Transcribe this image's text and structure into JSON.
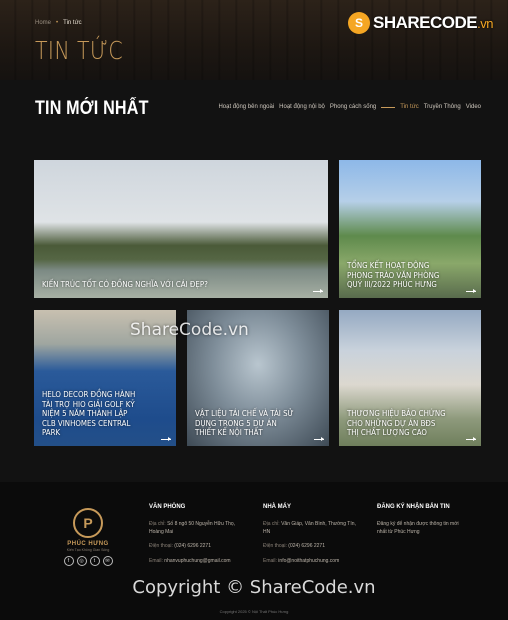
{
  "breadcrumb": {
    "home": "Home",
    "separator": "•",
    "current": "Tin tức"
  },
  "page_title": "TIN TỨC",
  "logo": {
    "mark": "S",
    "name": "SHARECODE",
    "suffix": ".vn"
  },
  "section_title": "TIN MỚI NHẤT",
  "tabs": [
    {
      "label": "Hoạt động bên ngoài"
    },
    {
      "label": "Hoạt động nội bộ"
    },
    {
      "label": "Phong cách sống"
    },
    {
      "label": "Tin tức"
    },
    {
      "label": "Truyền Thông"
    },
    {
      "label": "Video"
    }
  ],
  "articles": [
    {
      "title": "KIẾN TRÚC TỐT CÓ ĐỒNG NGHĨA VỚI CÁI ĐẸP?"
    },
    {
      "title": "TỔNG KẾT HOẠT ĐỘNG PHONG TRÀO VĂN PHÒNG QUÝ III/2022 PHÚC HƯNG"
    },
    {
      "title": "HELO DECOR ĐỒNG HÀNH TÀI TRỢ HIO GIẢI GOLF KỶ NIỆM 5 NĂM THÀNH LẬP CLB VINHOMES CENTRAL PARK"
    },
    {
      "title": "VẬT LIỆU TÁI CHẾ VÀ TÁI SỬ DỤNG TRONG 5 DỰ ÁN THIẾT KẾ NỘI THẤT"
    },
    {
      "title": "THƯƠNG HIỆU BẢO CHỨNG CHO NHỮNG DỰ ÁN BĐS THỊ CHẤT LƯỢNG CAO"
    }
  ],
  "watermark_center": "ShareCode.vn",
  "footer": {
    "brand": {
      "emblem": "P",
      "name": "PHÚC HƯNG",
      "tagline": "Kiến Tạo Không Gian Sống"
    },
    "socials": [
      "f",
      "◎",
      "t",
      "✉"
    ],
    "office": {
      "heading": "VĂN PHÒNG",
      "address_label": "Địa chỉ:",
      "address": "Số 8 ngõ 50 Nguyễn Hữu Thọ, Hoàng Mai",
      "phone_label": "Điện thoại:",
      "phone": "(024) 6296 2271",
      "email_label": "Email:",
      "email": "nhanvuphuchung@gmail.com"
    },
    "factory": {
      "heading": "NHÀ MÁY",
      "address_label": "Địa chỉ:",
      "address": "Văn Giáp, Văn Bình, Thường Tín, HN",
      "phone_label": "Điện thoại:",
      "phone": "(024) 6296 2271",
      "email_label": "Email:",
      "email": "info@noithatphuchung.com"
    },
    "newsletter": {
      "heading": "ĐĂNG KÝ NHẬN BẢN TIN",
      "text": "Đăng ký để nhận được thông tin mới nhất từ Phúc Hưng"
    },
    "watermark": "Copyright © ShareCode.vn",
    "copyright": "Copyright 2025 © Nội Thất Phúc Hưng"
  }
}
